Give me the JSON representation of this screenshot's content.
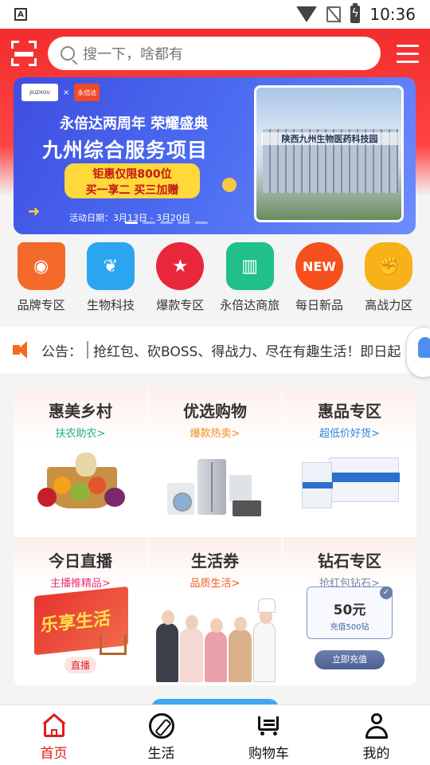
{
  "status_bar": {
    "time": "10:36",
    "left_icon_letter": "A"
  },
  "header": {
    "search_placeholder": "搜一下，啥都有"
  },
  "banner": {
    "logo_left": "JIUZHOU",
    "logo_right": "永倍达",
    "line1": "永倍达两周年 荣耀盛典",
    "line2": "九州综合服务项目",
    "pill_line1": "钜惠仅限800位",
    "pill_line2": "买一享二  买三加赠",
    "date": "活动日期：3月13日 - 3月20日",
    "photo_sign": "陕西九州生物医药科技园"
  },
  "categories": [
    {
      "label": "品牌专区",
      "icon": "crown-icon",
      "color": "#f46a2a"
    },
    {
      "label": "生物科技",
      "icon": "leaf-book-icon",
      "color": "#2aa6f0"
    },
    {
      "label": "爆款专区",
      "icon": "star-icon",
      "color": "#e8273a"
    },
    {
      "label": "永倍达商旅",
      "icon": "building-icon",
      "color": "#21c08a"
    },
    {
      "label": "每日新品",
      "icon": "new-badge-icon",
      "color": "#f5501d",
      "badge": "NEW"
    },
    {
      "label": "高战力区",
      "icon": "fist-icon",
      "color": "#f7b21a"
    }
  ],
  "notice": {
    "label": "公告：",
    "text": "抢红包、砍BOSS、得战力、尽在有趣生活！即日起"
  },
  "grid": [
    {
      "title": "惠美乡村",
      "subtitle": "扶农助农>",
      "sub_color": "#1eb08e"
    },
    {
      "title": "优选购物",
      "subtitle": "爆款热卖>",
      "sub_color": "#f08a1c"
    },
    {
      "title": "惠品专区",
      "subtitle": "超低价好货>",
      "sub_color": "#2c86e0"
    },
    {
      "title": "今日直播",
      "subtitle": "主播推精品>",
      "sub_color": "#e8327a",
      "tag": "直播",
      "poster_text": "乐享生活"
    },
    {
      "title": "生活券",
      "subtitle": "品质生活>",
      "sub_color": "#f05a1c"
    },
    {
      "title": "钻石专区",
      "subtitle": "抢红包钻石>",
      "sub_color": "#7a869e",
      "voucher_value": "50元",
      "voucher_sub": "充值500钻",
      "button": "立即充值"
    }
  ],
  "tabbar": [
    {
      "label": "首页",
      "active": true
    },
    {
      "label": "生活",
      "active": false
    },
    {
      "label": "购物车",
      "active": false
    },
    {
      "label": "我的",
      "active": false
    }
  ]
}
